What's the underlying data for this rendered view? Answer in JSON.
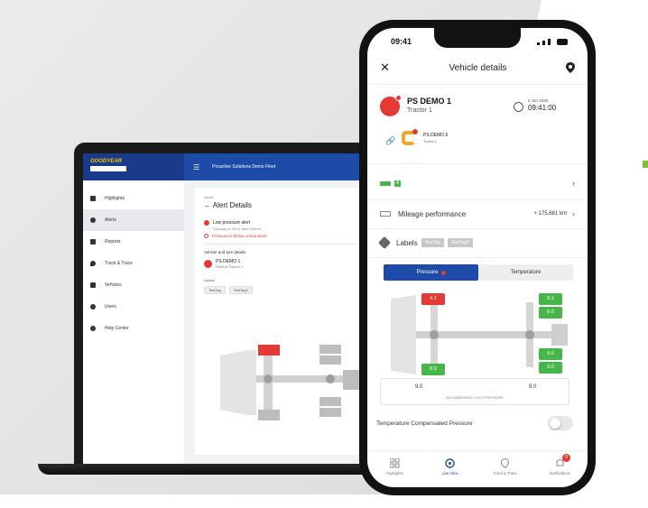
{
  "laptop": {
    "brand": "GOODYEAR",
    "top_bar_title": "Proactive Solutions Demo Fleet",
    "sidebar": {
      "items": [
        {
          "label": "Highlights",
          "icon": "highlights-icon"
        },
        {
          "label": "Alerts",
          "icon": "alerts-icon",
          "active": true
        },
        {
          "label": "Reports",
          "icon": "reports-icon"
        },
        {
          "label": "Track & Trace",
          "icon": "location-icon"
        },
        {
          "label": "Vehicles",
          "icon": "truck-icon"
        },
        {
          "label": "Users",
          "icon": "users-icon"
        },
        {
          "label": "Help Center",
          "icon": "help-icon"
        }
      ]
    },
    "detail": {
      "breadcrumb": "Alerts",
      "title": "Alert Details",
      "alert_title": "Low pressure alert",
      "alert_sub": "Tuesday at 09:41 alert vehicle",
      "alert_warning": "Pressure is below critical level",
      "section_title": "Vehicle and tyre details",
      "vehicle_name": "PS DEMO 1",
      "vehicle_sub": "Fleet to Tractor 1",
      "labels_title": "Labels",
      "tags": [
        "TestTag",
        "TestTag2"
      ]
    }
  },
  "phone": {
    "status_time": "09:41",
    "header_title": "Vehicle details",
    "vehicle": {
      "name": "PS DEMO 1",
      "sub": "Tractor 1",
      "date": "5 Jan 2022",
      "time": "09:41:00",
      "trailer_name": "PS DEMO 6",
      "trailer_sub": "Trailer 6"
    },
    "status_letter": "A",
    "mileage": {
      "label": "Mileage performance",
      "value": "+ 175,681 km"
    },
    "labels": {
      "label": "Labels",
      "tags": [
        "TestTag",
        "TestTag2"
      ]
    },
    "tabs": [
      {
        "label": "Pressure",
        "active": true
      },
      {
        "label": "Temperature",
        "active": false
      }
    ],
    "tires": {
      "front_left": "4.1",
      "rear_left": "8.9",
      "front_right_top": "9.1",
      "front_right_bottom": "9.0",
      "rear_right_top": "9.0",
      "rear_right_bottom": "9.0"
    },
    "recommended": {
      "front": "9.0",
      "rear": "9.0",
      "label": "RECOMMENDED COLD PRESSURE"
    },
    "temp_compensated_label": "Temperature Compensated Pressure",
    "nav": [
      {
        "label": "Highlights",
        "icon": "grid-icon"
      },
      {
        "label": "Live View",
        "icon": "live-view-icon",
        "active": true
      },
      {
        "label": "Track & Trace",
        "icon": "location-pin-icon"
      },
      {
        "label": "Notifications",
        "icon": "bell-icon",
        "badge": "0"
      }
    ]
  },
  "colors": {
    "brand_blue": "#1e4ba8",
    "alert_red": "#e53935",
    "ok_green": "#46b648",
    "trailer_orange": "#f5a623"
  }
}
